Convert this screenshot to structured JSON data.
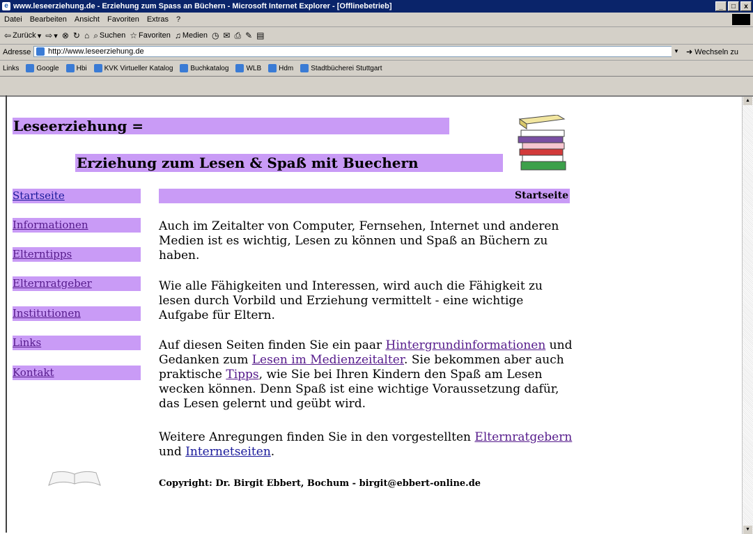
{
  "window": {
    "title": "www.leseerziehung.de - Erziehung zum Spass an Büchern - Microsoft Internet Explorer - [Offlinebetrieb]",
    "buttons": [
      "_",
      "□",
      "x"
    ]
  },
  "menu": [
    "Datei",
    "Bearbeiten",
    "Ansicht",
    "Favoriten",
    "Extras",
    "?"
  ],
  "toolbar": {
    "back": "Zurück",
    "search": "Suchen",
    "favorites": "Favoriten",
    "media": "Medien"
  },
  "address": {
    "label": "Adresse",
    "url": "http://www.leseerziehung.de",
    "go": "Wechseln zu"
  },
  "links_bar": {
    "label": "Links",
    "items": [
      "Google",
      "Hbi",
      "KVK Virtueller Katalog",
      "Buchkatalog",
      "WLB",
      "Hdm",
      "Stadtbücherei Stuttgart"
    ]
  },
  "page": {
    "header_line1": "Leseerziehung =",
    "header_line2": "Erziehung zum Lesen & Spaß mit Buechern",
    "nav": [
      "Startseite",
      "Informationen",
      "Elterntipps",
      "Elternratgeber",
      "Institutionen",
      "Links",
      "Kontakt"
    ],
    "breadcrumb": "Startseite",
    "p1": "Auch im Zeitalter von Computer, Fernsehen, Internet und anderen Medien ist es wichtig, Lesen zu können und Spaß an Büchern zu haben.",
    "p2": "Wie alle Fähigkeiten und Interessen, wird auch die Fähigkeit zu lesen durch Vorbild und Erziehung vermittelt - eine wichtige Aufgabe für Eltern.",
    "p3": {
      "t1": "Auf diesen Seiten finden Sie ein paar ",
      "link1": "Hintergrundinformationen",
      "t2": " und Gedanken zum ",
      "link2": "Lesen im Medienzeitalter",
      "t3": ". Sie bekommen aber auch praktische ",
      "link3": "Tipps",
      "t4": ", wie Sie bei Ihren Kindern den Spaß am Lesen wecken können. Denn Spaß ist eine wichtige Voraussetzung dafür, das Lesen gelernt und geübt wird."
    },
    "p4": {
      "t1": "Weitere Anregungen finden Sie in den vorgestellten ",
      "link1": "Elternratgebern",
      "t2": " und ",
      "link2": "Internetseiten",
      "t3": "."
    },
    "copyright": "Copyright: Dr. Birgit Ebbert, Bochum - birgit@ebbert-online.de"
  },
  "colors": {
    "accent": "#c99bf6",
    "titlebar": "#0a246a",
    "link_visited": "#551a8b",
    "link": "#1a1a9b"
  }
}
